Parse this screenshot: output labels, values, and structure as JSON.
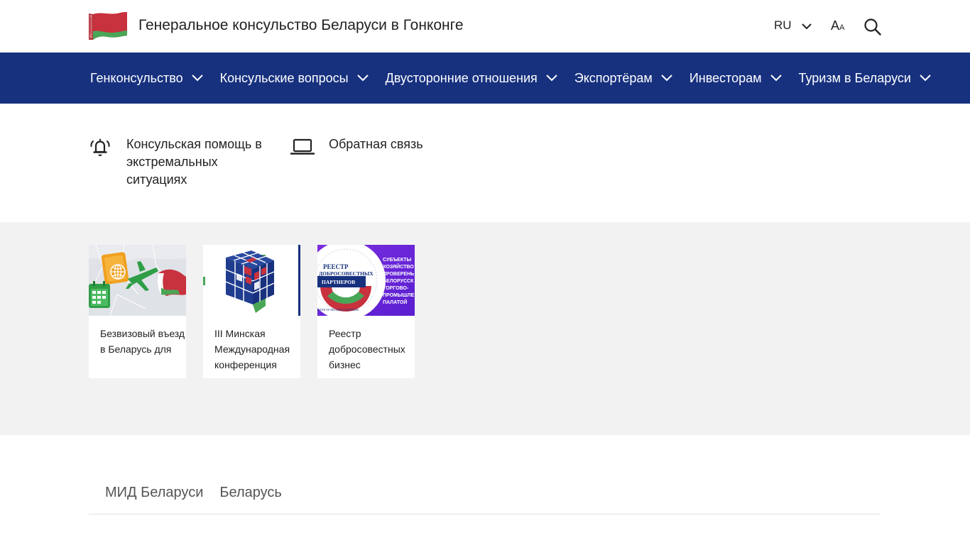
{
  "header": {
    "title": "Генеральное консульство Беларуси в Гонконге",
    "lang": "RU",
    "fontsize_big": "A",
    "fontsize_small": "A"
  },
  "nav": {
    "items": [
      {
        "label": "Генконсульство"
      },
      {
        "label": "Консульские вопросы"
      },
      {
        "label": "Двусторонние отношения"
      },
      {
        "label": "Экспортёрам"
      },
      {
        "label": "Инвесторам"
      },
      {
        "label": "Туризм в Беларуси"
      }
    ]
  },
  "quick_links": [
    {
      "label": "Консульская помощь в экстремальных ситуациях",
      "icon": "alarm-bell-icon"
    },
    {
      "label": "Обратная связь",
      "icon": "laptop-icon"
    }
  ],
  "cards": [
    {
      "text": "Безвизовый въезд в Беларусь для"
    },
    {
      "text": "III Минская Международная конференция"
    },
    {
      "text": "Реестр добросовестных бизнес"
    }
  ],
  "card_images": {
    "registry_title_1": "РЕЕСТР",
    "registry_title_2": "ДОБРОСОВЕСТНЫХ",
    "registry_title_3": "ПАРТНЕРОВ",
    "registry_sub": "ISTER OF RELIABLE PARTNERS",
    "registry_right": [
      "СУБЪЕКТЫ",
      "ХОЗЯЙСТВО",
      "ПРОВЕРЕНЬ",
      "БЕЛОРУССК",
      "ТОРГОВО-",
      "ПРОМЫШЛЕ",
      "ПАЛАТОЙ"
    ]
  },
  "footer": {
    "links": [
      {
        "label": "МИД Беларуси"
      },
      {
        "label": "Беларусь"
      }
    ]
  },
  "colors": {
    "nav_bg": "#17317f",
    "section_bg": "#f2f2f2",
    "flag_red": "#c8313e",
    "flag_green": "#4aa657"
  }
}
